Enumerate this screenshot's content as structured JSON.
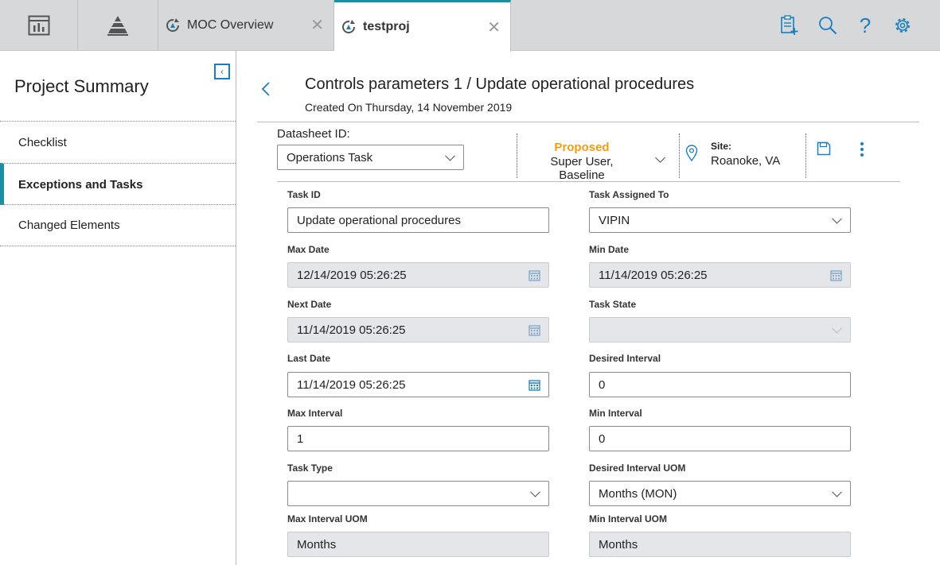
{
  "topbar": {
    "tabs": [
      {
        "label": "MOC Overview"
      },
      {
        "label": "testproj"
      }
    ]
  },
  "sidebar": {
    "title": "Project Summary",
    "items": [
      {
        "label": "Checklist"
      },
      {
        "label": "Exceptions and Tasks"
      },
      {
        "label": "Changed Elements"
      }
    ]
  },
  "header": {
    "title": "Controls parameters 1 / Update operational procedures",
    "subtitle": "Created On Thursday, 14 November 2019"
  },
  "datasheet": {
    "label": "Datasheet ID:",
    "value": "Operations Task"
  },
  "state": {
    "status": "Proposed",
    "user": "Super User, Baseline"
  },
  "site": {
    "label": "Site:",
    "value": "Roanoke, VA"
  },
  "colors": {
    "accent": "#1a8fa6",
    "status": "#f39c12",
    "icon": "#1a7fbf"
  },
  "form": {
    "task_id": {
      "label": "Task ID",
      "value": "Update operational procedures"
    },
    "task_assigned_to": {
      "label": "Task Assigned To",
      "value": "VIPIN"
    },
    "max_date": {
      "label": "Max Date",
      "value": "12/14/2019 05:26:25"
    },
    "min_date": {
      "label": "Min Date",
      "value": "11/14/2019 05:26:25"
    },
    "next_date": {
      "label": "Next Date",
      "value": "11/14/2019 05:26:25"
    },
    "task_state": {
      "label": "Task State",
      "value": ""
    },
    "last_date": {
      "label": "Last Date",
      "value": "11/14/2019 05:26:25"
    },
    "desired_interval": {
      "label": "Desired Interval",
      "value": "0"
    },
    "max_interval": {
      "label": "Max Interval",
      "value": "1"
    },
    "min_interval": {
      "label": "Min Interval",
      "value": "0"
    },
    "task_type": {
      "label": "Task Type",
      "value": ""
    },
    "desired_interval_uom": {
      "label": "Desired Interval UOM",
      "value": "Months (MON)"
    },
    "max_interval_uom": {
      "label": "Max Interval UOM",
      "value": "Months"
    },
    "min_interval_uom": {
      "label": "Min Interval UOM",
      "value": "Months"
    }
  }
}
